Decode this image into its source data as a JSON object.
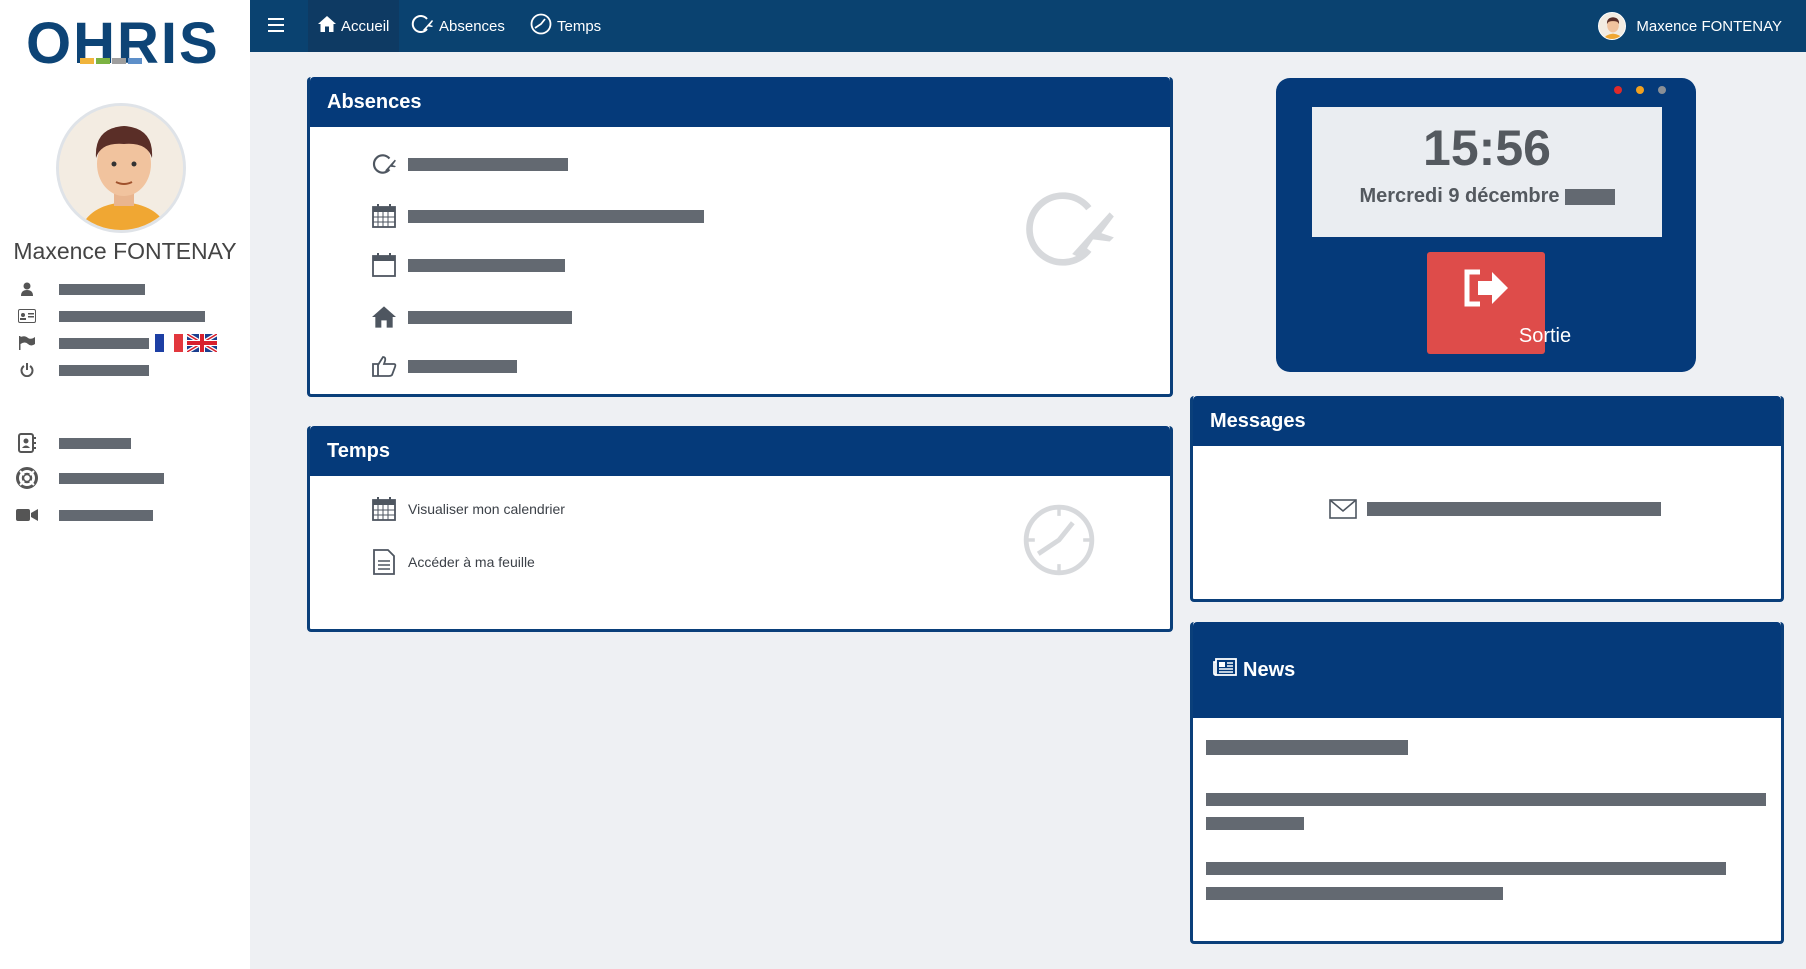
{
  "sidebar": {
    "logo_text": "OHRIS",
    "user_name": "Maxence FONTENAY"
  },
  "topbar": {
    "nav": [
      {
        "label": "Accueil",
        "icon": "home-icon",
        "active": true
      },
      {
        "label": "Absences",
        "icon": "absence-plane-icon",
        "active": false
      },
      {
        "label": "Temps",
        "icon": "clock-icon",
        "active": false
      }
    ],
    "user_name": "Maxence FONTENAY"
  },
  "absences": {
    "title": "Absences"
  },
  "temps": {
    "title": "Temps",
    "items": [
      {
        "label": "Visualiser mon calendrier",
        "icon": "calendar-icon"
      },
      {
        "label": "Accéder à ma feuille",
        "icon": "document-icon"
      }
    ]
  },
  "clock": {
    "time": "15:56",
    "date": "Mercredi 9 décembre",
    "button_label": "Sortie"
  },
  "messages": {
    "title": "Messages"
  },
  "news": {
    "title": "News"
  },
  "colors": {
    "primary": "#053a7a",
    "topbar": "#0a4270",
    "danger": "#de4c4a",
    "placeholder": "#636971"
  }
}
